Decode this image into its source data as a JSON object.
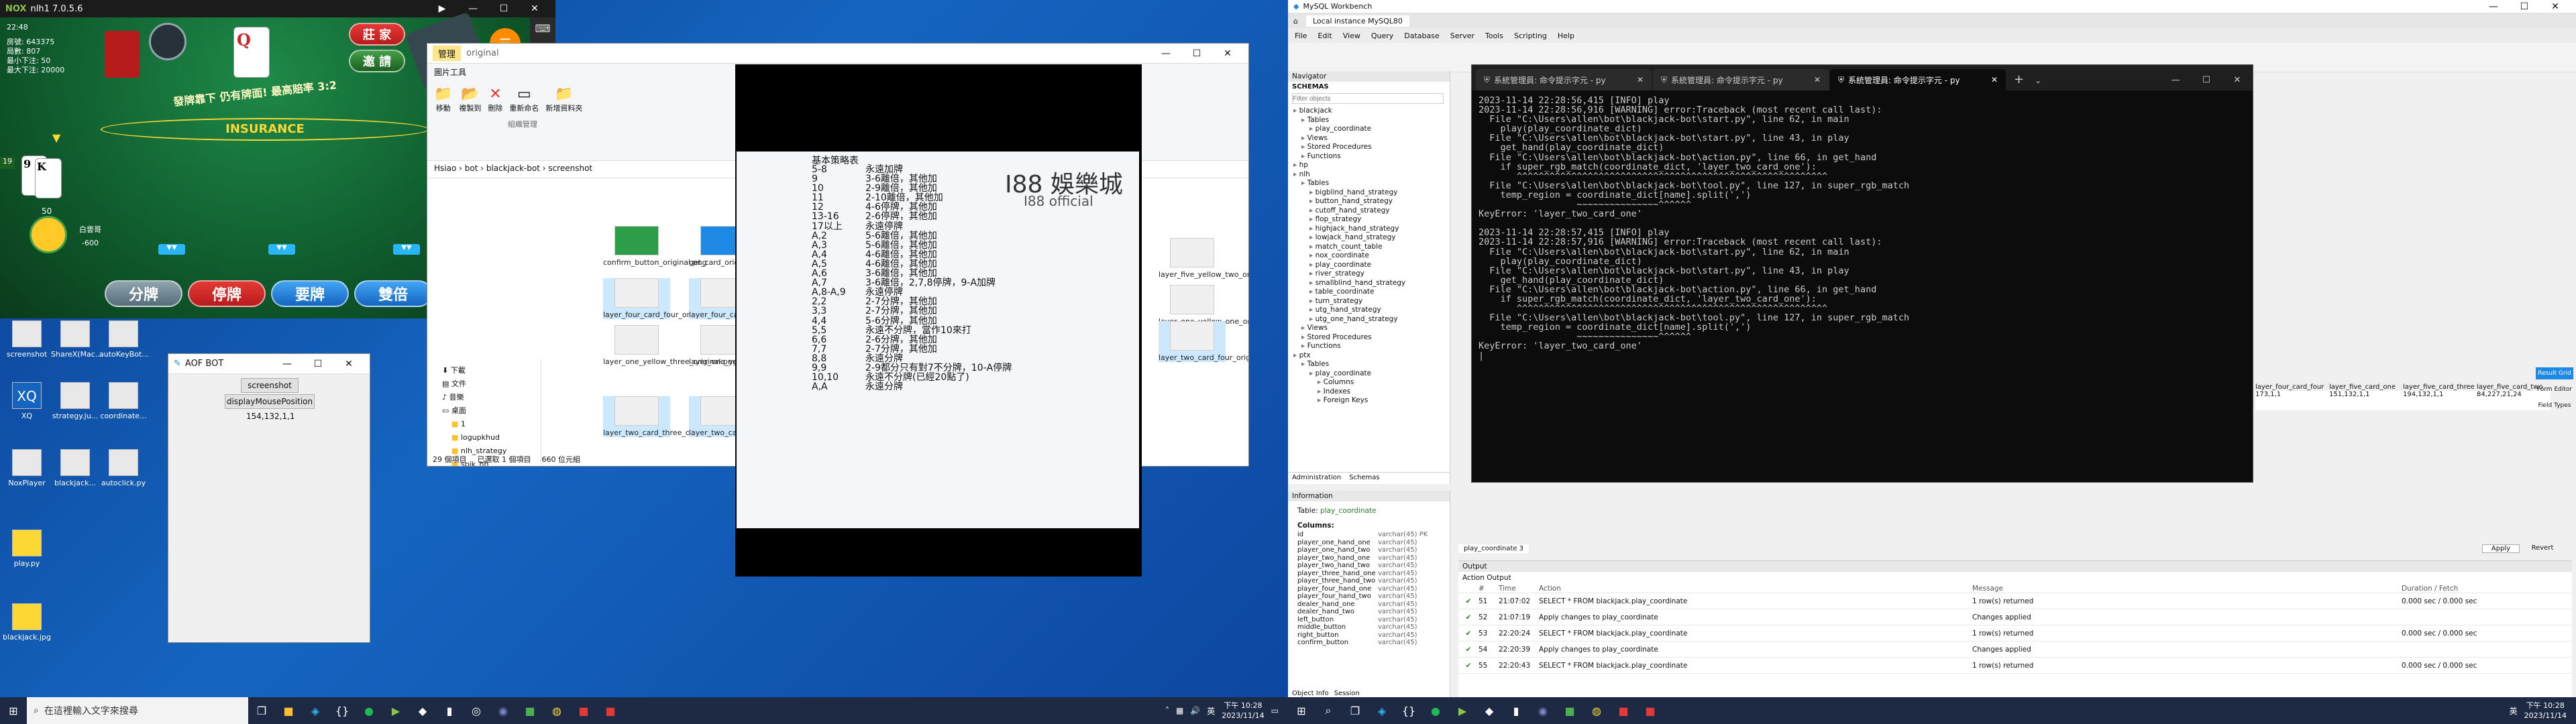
{
  "nox": {
    "title": "nlh1 7.0.5.6",
    "time": "22:48",
    "table_info": [
      "房號: 643375",
      "局數: 807",
      "最小下注: 50",
      "最大下注: 20000"
    ],
    "table_banner": "發牌靠下 仍有牌面! 最高賠率 3:2",
    "insurance_text": "INSURANCE",
    "dealer_card": "Q",
    "player_cards": [
      "9",
      "K"
    ],
    "player_total": "19",
    "chip_amount": "50",
    "player_balance": "-600",
    "player_name": "白雲哥",
    "side_buttons": [
      "莊 家",
      "邀 請"
    ],
    "action_buttons": [
      "分牌",
      "停牌",
      "要牌",
      "雙倍"
    ]
  },
  "desktop_icons": [
    {
      "label": "screenshot"
    },
    {
      "label": "ShareX(Mac..."
    },
    {
      "label": "autoKeyBot..."
    },
    {
      "label": "XQ"
    },
    {
      "label": "strategy.ju..."
    },
    {
      "label": "coordinate..."
    },
    {
      "label": "NoxPlayer"
    },
    {
      "label": "blackjack..."
    },
    {
      "label": "autoclick.py"
    },
    {
      "label": "play.py"
    },
    {
      "label": "blackjack.jpg"
    }
  ],
  "aof_bot": {
    "title": "AOF BOT",
    "screenshot_button": "screenshot",
    "mouse_button": "displayMousePosition",
    "position_value": "154,132,1,1"
  },
  "explorer": {
    "title_tab": "管理",
    "folder_name": "original",
    "address": "Hsiao › bot › blackjack-bot › screenshot",
    "ribbon_tab": "圖片工具",
    "ribbon_group": "組織管理",
    "ribbon_buttons": [
      "移動",
      "複製到",
      "刪除",
      "重新命名",
      "新增資料夾"
    ],
    "nav_items": [
      "下載",
      "文件",
      "音樂",
      "桌面",
      "1",
      "logupkhud",
      "nlh_strategy",
      "spik_hh"
    ],
    "files": [
      "confirm_button_original.png",
      "get_card_original.png",
      "layer_four_card_four_original.png",
      "layer_four_card_three_original.png",
      "layer_one_yellow_three_original.png",
      "layer_one_yellow_two_original.png",
      "layer_two_card_three_original.png",
      "layer_two_card_one_original.png",
      "layer_five_yellow_two_original.png",
      "layer_one_yellow_one_original.png",
      "layer_two_card_four_original.png"
    ],
    "status_left": "29 個項目",
    "status_mid": "已選取 1 個項目",
    "status_right": "660 位元組"
  },
  "strategy": {
    "heading": "基本策略表",
    "rows": [
      [
        "5-8",
        "永遠加牌"
      ],
      [
        "9",
        "3-6離倍，其他加"
      ],
      [
        "10",
        "2-9離倍，其他加"
      ],
      [
        "11",
        "2-10離倍，其他加"
      ],
      [
        "12",
        "4-6停牌，其他加"
      ],
      [
        "13-16",
        "2-6停牌，其他加"
      ],
      [
        "17以上",
        "永遠停牌"
      ],
      [
        "A,2",
        "5-6離倍，其他加"
      ],
      [
        "A,3",
        "5-6離倍，其他加"
      ],
      [
        "A,4",
        "4-6離倍，其他加"
      ],
      [
        "A,5",
        "4-6離倍，其他加"
      ],
      [
        "A,6",
        "3-6離倍，其他加"
      ],
      [
        "A,7",
        "3-6離倍，2,7,8停牌，9-A加牌"
      ],
      [
        "A,8-A,9",
        "永遠停牌"
      ],
      [
        "2,2",
        "2-7分牌，其他加"
      ],
      [
        "3,3",
        "2-7分牌，其他加"
      ],
      [
        "4,4",
        "5-6分牌，其他加"
      ],
      [
        "5,5",
        "永遠不分牌，當作10來打"
      ],
      [
        "6,6",
        "2-6分牌，其他加"
      ],
      [
        "7,7",
        "2-7分牌，其他加"
      ],
      [
        "8,8",
        "永遠分牌"
      ],
      [
        "9,9",
        "2-9都分只有對7不分牌，10-A停牌"
      ],
      [
        "10,10",
        "永遠不分牌(已經20點了)"
      ],
      [
        "A,A",
        "永遠分牌"
      ]
    ],
    "brand_main": "I88 娛樂城",
    "brand_sub": "I88 official"
  },
  "workbench": {
    "title": "MySQL Workbench",
    "connection_tab": "Local instance MySQL80",
    "menu": [
      "File",
      "Edit",
      "View",
      "Query",
      "Database",
      "Server",
      "Tools",
      "Scripting",
      "Help"
    ],
    "navigator_label": "Navigator",
    "schemas_label": "SCHEMAS",
    "filter_placeholder": "Filter objects",
    "tree": [
      "blackjack",
      "Tables",
      "play_coordinate",
      "Views",
      "Stored Procedures",
      "Functions",
      "hp",
      "nlh",
      "Tables",
      "bigblind_hand_strategy",
      "button_hand_strategy",
      "cutoff_hand_strategy",
      "flop_strategy",
      "highjack_hand_strategy",
      "lowjack_hand_strategy",
      "match_count_table",
      "nox_coordinate",
      "play_coordinate",
      "river_strategy",
      "smallblind_hand_strategy",
      "table_coordinate",
      "turn_strategy",
      "utg_hand_strategy",
      "utg_one_hand_strategy",
      "Views",
      "Stored Procedures",
      "Functions",
      "ptx",
      "Tables",
      "play_coordinate",
      "Columns",
      "Indexes",
      "Foreign Keys"
    ],
    "admin_tab": "Administration",
    "schemas_tab": "Schemas",
    "info_label": "Information",
    "table_label": "Table:",
    "table_name": "play_coordinate",
    "columns_label": "Columns:",
    "columns": [
      [
        "id",
        "varchar(45) PK"
      ],
      [
        "player_one_hand_one",
        "varchar(45)"
      ],
      [
        "player_one_hand_two",
        "varchar(45)"
      ],
      [
        "player_two_hand_one",
        "varchar(45)"
      ],
      [
        "player_two_hand_two",
        "varchar(45)"
      ],
      [
        "player_three_hand_one",
        "varchar(45)"
      ],
      [
        "player_three_hand_two",
        "varchar(45)"
      ],
      [
        "player_four_hand_one",
        "varchar(45)"
      ],
      [
        "player_four_hand_two",
        "varchar(45)"
      ],
      [
        "dealer_hand_one",
        "varchar(45)"
      ],
      [
        "dealer_hand_two",
        "varchar(45)"
      ],
      [
        "left_button",
        "varchar(45)"
      ],
      [
        "middle_button",
        "varchar(45)"
      ],
      [
        "right_button",
        "varchar(45)"
      ],
      [
        "confirm_button",
        "varchar(45)"
      ]
    ],
    "object_info_tab": "Object Info",
    "session_tab": "Session",
    "result_headers": [
      "layer_four_card_four",
      "layer_five_card_one",
      "layer_five_card_three",
      "layer_five_card_two"
    ],
    "result_values": [
      "151,132,1,1",
      "194,132,1,1",
      "84,227,21,24"
    ],
    "result_left_value": "173,1,1",
    "result_tab": "play_coordinate 3",
    "apply_button": "Apply",
    "revert_button": "Revert",
    "right_panel": [
      "Result Grid",
      "Form Editor",
      "Field Types"
    ],
    "output_label": "Output",
    "action_output": "Action Output",
    "output_headers": [
      "#",
      "Time",
      "Action",
      "Message",
      "Duration / Fetch"
    ],
    "output_rows": [
      [
        "51",
        "21:07:02",
        "SELECT * FROM blackjack.play_coordinate",
        "1 row(s) returned",
        "0.000 sec / 0.000 sec"
      ],
      [
        "52",
        "21:07:19",
        "Apply changes to play_coordinate",
        "Changes applied",
        ""
      ],
      [
        "53",
        "22:20:24",
        "SELECT * FROM blackjack.play_coordinate",
        "1 row(s) returned",
        "0.000 sec / 0.000 sec"
      ],
      [
        "54",
        "22:20:39",
        "Apply changes to play_coordinate",
        "Changes applied",
        ""
      ],
      [
        "55",
        "22:20:43",
        "SELECT * FROM blackjack.play_coordinate",
        "1 row(s) returned",
        "0.000 sec / 0.000 sec"
      ]
    ]
  },
  "terminal": {
    "tabs": [
      "系統管理員: 命令提示字元 - py",
      "系統管理員: 命令提示字元 - py",
      "系統管理員: 命令提示字元 - py"
    ],
    "lines": [
      "2023-11-14 22:28:56,415 [INFO] play",
      "2023-11-14 22:28:56,916 [WARNING] error:Traceback (most recent call last):",
      "  File \"C:\\Users\\allen\\bot\\blackjack-bot\\start.py\", line 62, in main",
      "    play(play_coordinate_dict)",
      "  File \"C:\\Users\\allen\\bot\\blackjack-bot\\start.py\", line 43, in play",
      "    get_hand(play_coordinate_dict)",
      "  File \"C:\\Users\\allen\\bot\\blackjack-bot\\action.py\", line 66, in get_hand",
      "    if super_rgb_match(coordinate_dict, 'layer_two_card_one'):",
      "       ^^^^^^^^^^^^^^^^^^^^^^^^^^^^^^^^^^^^^^^^^^^^^^^^^^^^^^^^^",
      "  File \"C:\\Users\\allen\\bot\\blackjack-bot\\tool.py\", line 127, in super_rgb_match",
      "    temp_region = coordinate_dict[name].split(',')",
      "                  ~~~~~~~~~~~~~~~^^^^^^",
      "KeyError: 'layer_two_card_one'",
      "",
      "2023-11-14 22:28:57,415 [INFO] play",
      "2023-11-14 22:28:57,916 [WARNING] error:Traceback (most recent call last):",
      "  File \"C:\\Users\\allen\\bot\\blackjack-bot\\start.py\", line 62, in main",
      "    play(play_coordinate_dict)",
      "  File \"C:\\Users\\allen\\bot\\blackjack-bot\\start.py\", line 43, in play",
      "    get_hand(play_coordinate_dict)",
      "  File \"C:\\Users\\allen\\bot\\blackjack-bot\\action.py\", line 66, in get_hand",
      "    if super_rgb_match(coordinate_dict, 'layer_two_card_one'):",
      "       ^^^^^^^^^^^^^^^^^^^^^^^^^^^^^^^^^^^^^^^^^^^^^^^^^^^^^^^^^",
      "  File \"C:\\Users\\allen\\bot\\blackjack-bot\\tool.py\", line 127, in super_rgb_match",
      "    temp_region = coordinate_dict[name].split(',')",
      "                  ~~~~~~~~~~~~~~~^^^^^^",
      "KeyError: 'layer_two_card_one'"
    ]
  },
  "taskbar_left": {
    "search_placeholder": "在這裡輸入文字來搜尋",
    "time": "下午 10:28",
    "date": "2023/11/14",
    "lang": "英"
  },
  "taskbar_right": {
    "time": "下午 10:28",
    "date": "2023/11/14",
    "lang": "英"
  }
}
